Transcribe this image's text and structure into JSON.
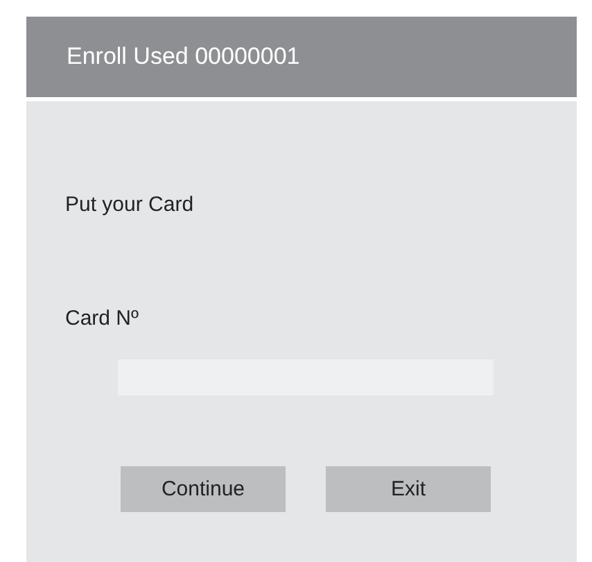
{
  "window": {
    "title": "Enroll Used 00000001"
  },
  "prompt": "Put your Card",
  "card_field": {
    "label": "Card Nº"
  },
  "buttons": [
    {
      "label": "Continue"
    },
    {
      "label": "Exit"
    }
  ]
}
